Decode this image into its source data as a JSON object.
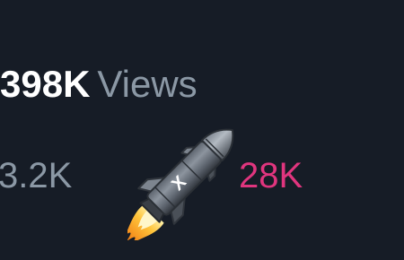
{
  "views": {
    "count": "398K",
    "label": "Views"
  },
  "stats": {
    "left_value": "3.2K",
    "right_value": "28K"
  },
  "rocket": {
    "icon": "rocket-icon",
    "emblem_text": "X"
  },
  "colors": {
    "background": "#161c26",
    "muted_text": "#8b98a5",
    "primary_text": "#ffffff",
    "like_accent": "#e0357e"
  }
}
